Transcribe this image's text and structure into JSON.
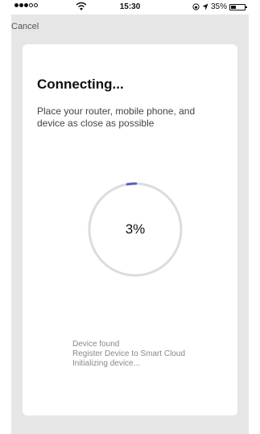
{
  "status_bar": {
    "time": "15:30",
    "battery": "35%",
    "battery_level": 0.35
  },
  "nav": {
    "cancel_label": "Cancel"
  },
  "card": {
    "title": "Connecting...",
    "subtitle": "Place your router, mobile phone, and device as close as possible",
    "progress_value": 3,
    "progress_label": "3%",
    "status_lines": [
      "Device found",
      "Register Device to Smart Cloud",
      "Initializing device..."
    ]
  },
  "colors": {
    "accent": "#5a5fb8",
    "track": "#dcdcdc",
    "background": "#e6e6e6",
    "card": "#ffffff"
  }
}
